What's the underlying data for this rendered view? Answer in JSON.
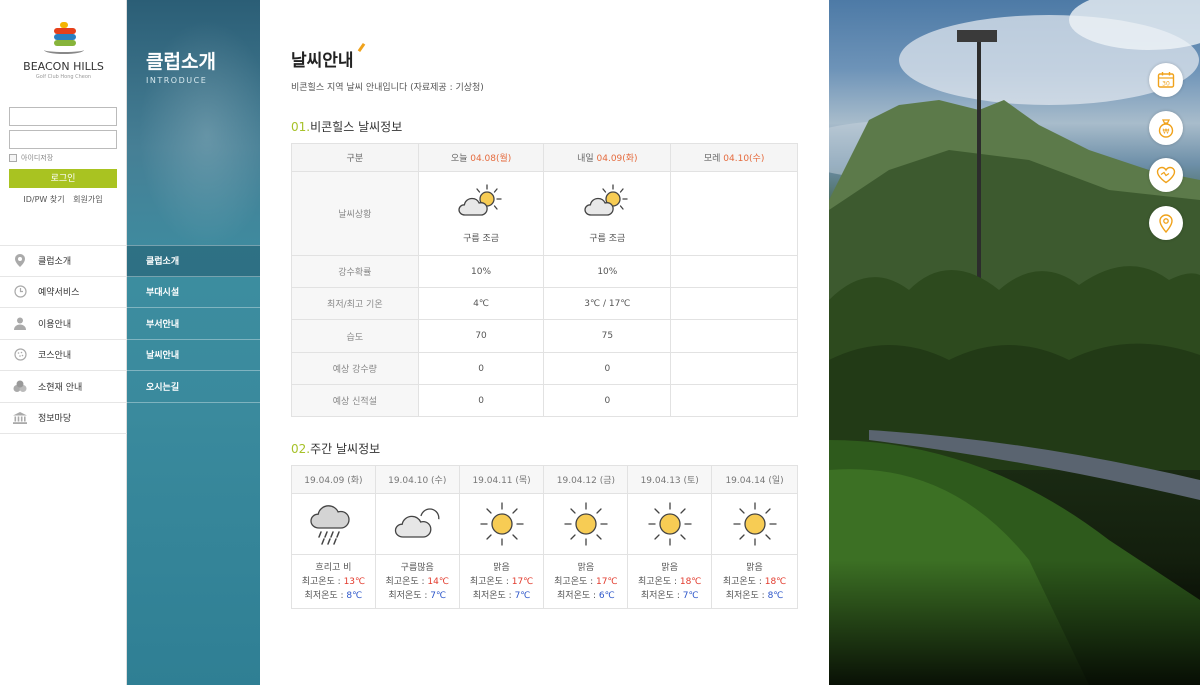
{
  "brand": {
    "name": "BEACON HILLS",
    "sub": "Golf Club Hong Cheon"
  },
  "login": {
    "remember_label": "아이디저장",
    "login_button": "로그인",
    "find_link": "ID/PW 찾기",
    "join_link": "회원가입"
  },
  "main_nav": [
    {
      "label": "클럽소개",
      "icon": "location-pin-icon"
    },
    {
      "label": "예약서비스",
      "icon": "clock-icon"
    },
    {
      "label": "이용안내",
      "icon": "person-icon"
    },
    {
      "label": "코스안내",
      "icon": "golf-ball-icon"
    },
    {
      "label": "소현재 안내",
      "icon": "balls-icon"
    },
    {
      "label": "정보마당",
      "icon": "building-icon"
    }
  ],
  "section": {
    "title": "클럽소개",
    "subtitle": "INTRODUCE",
    "items": [
      "클럽소개",
      "부대시설",
      "부서안내",
      "날씨안내",
      "오시는길"
    ]
  },
  "page": {
    "title": "날씨안내",
    "description": "비콘힐스 지역 날씨 안내입니다 (자료제공 : 기상청)"
  },
  "today": {
    "heading_num": "01.",
    "heading_text": "비콘힐스 날씨정보",
    "col_label": "구분",
    "columns": [
      {
        "prefix": "오늘 ",
        "date": "04.08(월)"
      },
      {
        "prefix": "내일 ",
        "date": "04.09(화)"
      },
      {
        "prefix": "모레 ",
        "date": "04.10(수)"
      }
    ],
    "condition_label": "날씨상황",
    "conditions": [
      "구름 조금",
      "구름 조금",
      ""
    ],
    "condition_icons": [
      "partly-cloudy-icon",
      "partly-cloudy-icon",
      ""
    ],
    "rows": [
      {
        "label": "강수확률",
        "values": [
          "10%",
          "10%",
          ""
        ]
      },
      {
        "label": "최저/최고 기온",
        "values": [
          "4℃",
          "3℃ / 17℃",
          ""
        ]
      },
      {
        "label": "습도",
        "values": [
          "70",
          "75",
          ""
        ]
      },
      {
        "label": "예상 강수량",
        "values": [
          "0",
          "0",
          ""
        ]
      },
      {
        "label": "예상 신적설",
        "values": [
          "0",
          "0",
          ""
        ]
      }
    ]
  },
  "weekly": {
    "heading_num": "02.",
    "heading_text": "주간 날씨정보",
    "high_label": "최고온도 : ",
    "low_label": "최저온도 : ",
    "days": [
      {
        "date": "19.04.09 (화)",
        "icon": "rain-cloud-icon",
        "condition": "흐리고 비",
        "high": "13℃",
        "low": "8℃"
      },
      {
        "date": "19.04.10 (수)",
        "icon": "cloudy-icon",
        "condition": "구름많음",
        "high": "14℃",
        "low": "7℃"
      },
      {
        "date": "19.04.11 (목)",
        "icon": "sunny-icon",
        "condition": "맑음",
        "high": "17℃",
        "low": "7℃"
      },
      {
        "date": "19.04.12 (금)",
        "icon": "sunny-icon",
        "condition": "맑음",
        "high": "17℃",
        "low": "6℃"
      },
      {
        "date": "19.04.13 (토)",
        "icon": "sunny-icon",
        "condition": "맑음",
        "high": "18℃",
        "low": "7℃"
      },
      {
        "date": "19.04.14 (일)",
        "icon": "sunny-icon",
        "condition": "맑음",
        "high": "18℃",
        "low": "8℃"
      }
    ]
  },
  "quick_menu": [
    {
      "icon": "calendar-icon",
      "text": "30"
    },
    {
      "icon": "money-bag-icon",
      "text": "₩"
    },
    {
      "icon": "heart-icon",
      "text": ""
    },
    {
      "icon": "location-pin-icon",
      "text": ""
    }
  ],
  "colors": {
    "accent_green": "#a9c321",
    "accent_orange": "#e56b3e",
    "teal": "#3a8a9d",
    "icon_orange": "#f0a21b"
  }
}
